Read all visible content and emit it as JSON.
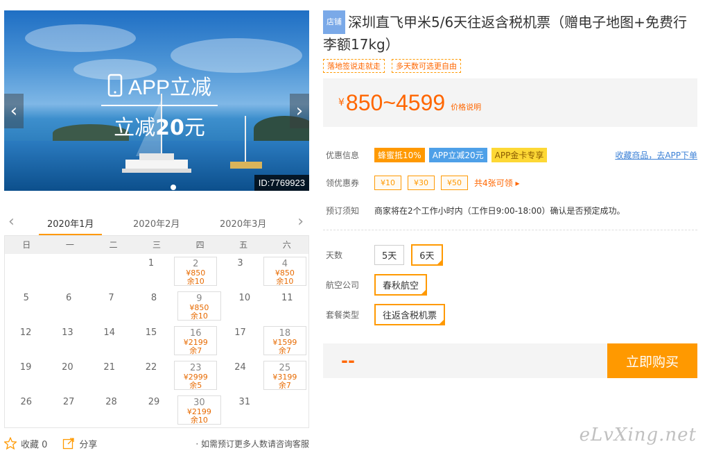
{
  "banner": {
    "promo_line1": "APP立减",
    "promo_line2_prefix": "立减",
    "promo_line2_amount": "20",
    "promo_line2_suffix": "元",
    "id_badge": "ID:7769923",
    "prev_glyph": "‹",
    "next_glyph": "›"
  },
  "calendar": {
    "months": [
      "2020年1月",
      "2020年2月",
      "2020年3月"
    ],
    "active_month": 0,
    "weekdays": [
      "日",
      "一",
      "二",
      "三",
      "四",
      "五",
      "六"
    ],
    "weeks": [
      [
        {
          "d": ""
        },
        {
          "d": ""
        },
        {
          "d": ""
        },
        {
          "d": "1"
        },
        {
          "d": "2",
          "p": "¥850",
          "s": "余10"
        },
        {
          "d": "3"
        },
        {
          "d": "4",
          "p": "¥850",
          "s": "余10"
        }
      ],
      [
        {
          "d": "5"
        },
        {
          "d": "6"
        },
        {
          "d": "7"
        },
        {
          "d": "8"
        },
        {
          "d": "9",
          "p": "¥850",
          "s": "余10"
        },
        {
          "d": "10"
        },
        {
          "d": "11"
        }
      ],
      [
        {
          "d": "12"
        },
        {
          "d": "13"
        },
        {
          "d": "14"
        },
        {
          "d": "15"
        },
        {
          "d": "16",
          "p": "¥2199",
          "s": "余7"
        },
        {
          "d": "17"
        },
        {
          "d": "18",
          "p": "¥1599",
          "s": "余7"
        }
      ],
      [
        {
          "d": "19"
        },
        {
          "d": "20"
        },
        {
          "d": "21"
        },
        {
          "d": "22"
        },
        {
          "d": "23",
          "p": "¥2999",
          "s": "余5"
        },
        {
          "d": "24"
        },
        {
          "d": "25",
          "p": "¥3199",
          "s": "余7"
        }
      ],
      [
        {
          "d": "26"
        },
        {
          "d": "27"
        },
        {
          "d": "28"
        },
        {
          "d": "29"
        },
        {
          "d": "30",
          "p": "¥2199",
          "s": "余10"
        },
        {
          "d": "31"
        },
        {
          "d": ""
        }
      ]
    ]
  },
  "footer": {
    "favorite": "收藏 0",
    "share": "分享",
    "note": "· 如需预订更多人数请咨询客服"
  },
  "product": {
    "shop_tag": "店铺",
    "title": "深圳直飞甲米5/6天往返含税机票（赠电子地图+免费行李额17kg）",
    "tags": [
      "落地签说走就走",
      "多天数可选更自由"
    ],
    "price_yen": "¥",
    "price_range": "850~4599",
    "price_desc": "价格说明"
  },
  "info": {
    "discount_label": "优惠信息",
    "discount_tags": [
      "蜂蜜抵10%",
      "APP立减20元",
      "APP金卡专享"
    ],
    "fav_link": "收藏商品，去APP下单",
    "coupon_label": "领优惠券",
    "coupons": [
      "¥10",
      "¥30",
      "¥50"
    ],
    "coupon_more": "共4张可领 ▸",
    "notice_label": "预订须知",
    "notice_text": "商家将在2个工作小时内（工作日9:00-18:00）确认是否预定成功。"
  },
  "options": {
    "days_label": "天数",
    "days": [
      "5天",
      "6天"
    ],
    "days_selected": 1,
    "airline_label": "航空公司",
    "airline": "春秋航空",
    "package_label": "套餐类型",
    "package": "往返含税机票"
  },
  "buy": {
    "total": "--",
    "button": "立即购买"
  },
  "watermark": "eLvXing.net",
  "colors": {
    "accent": "#ff9900",
    "price": "#ff6600",
    "link": "#3b80d6"
  }
}
